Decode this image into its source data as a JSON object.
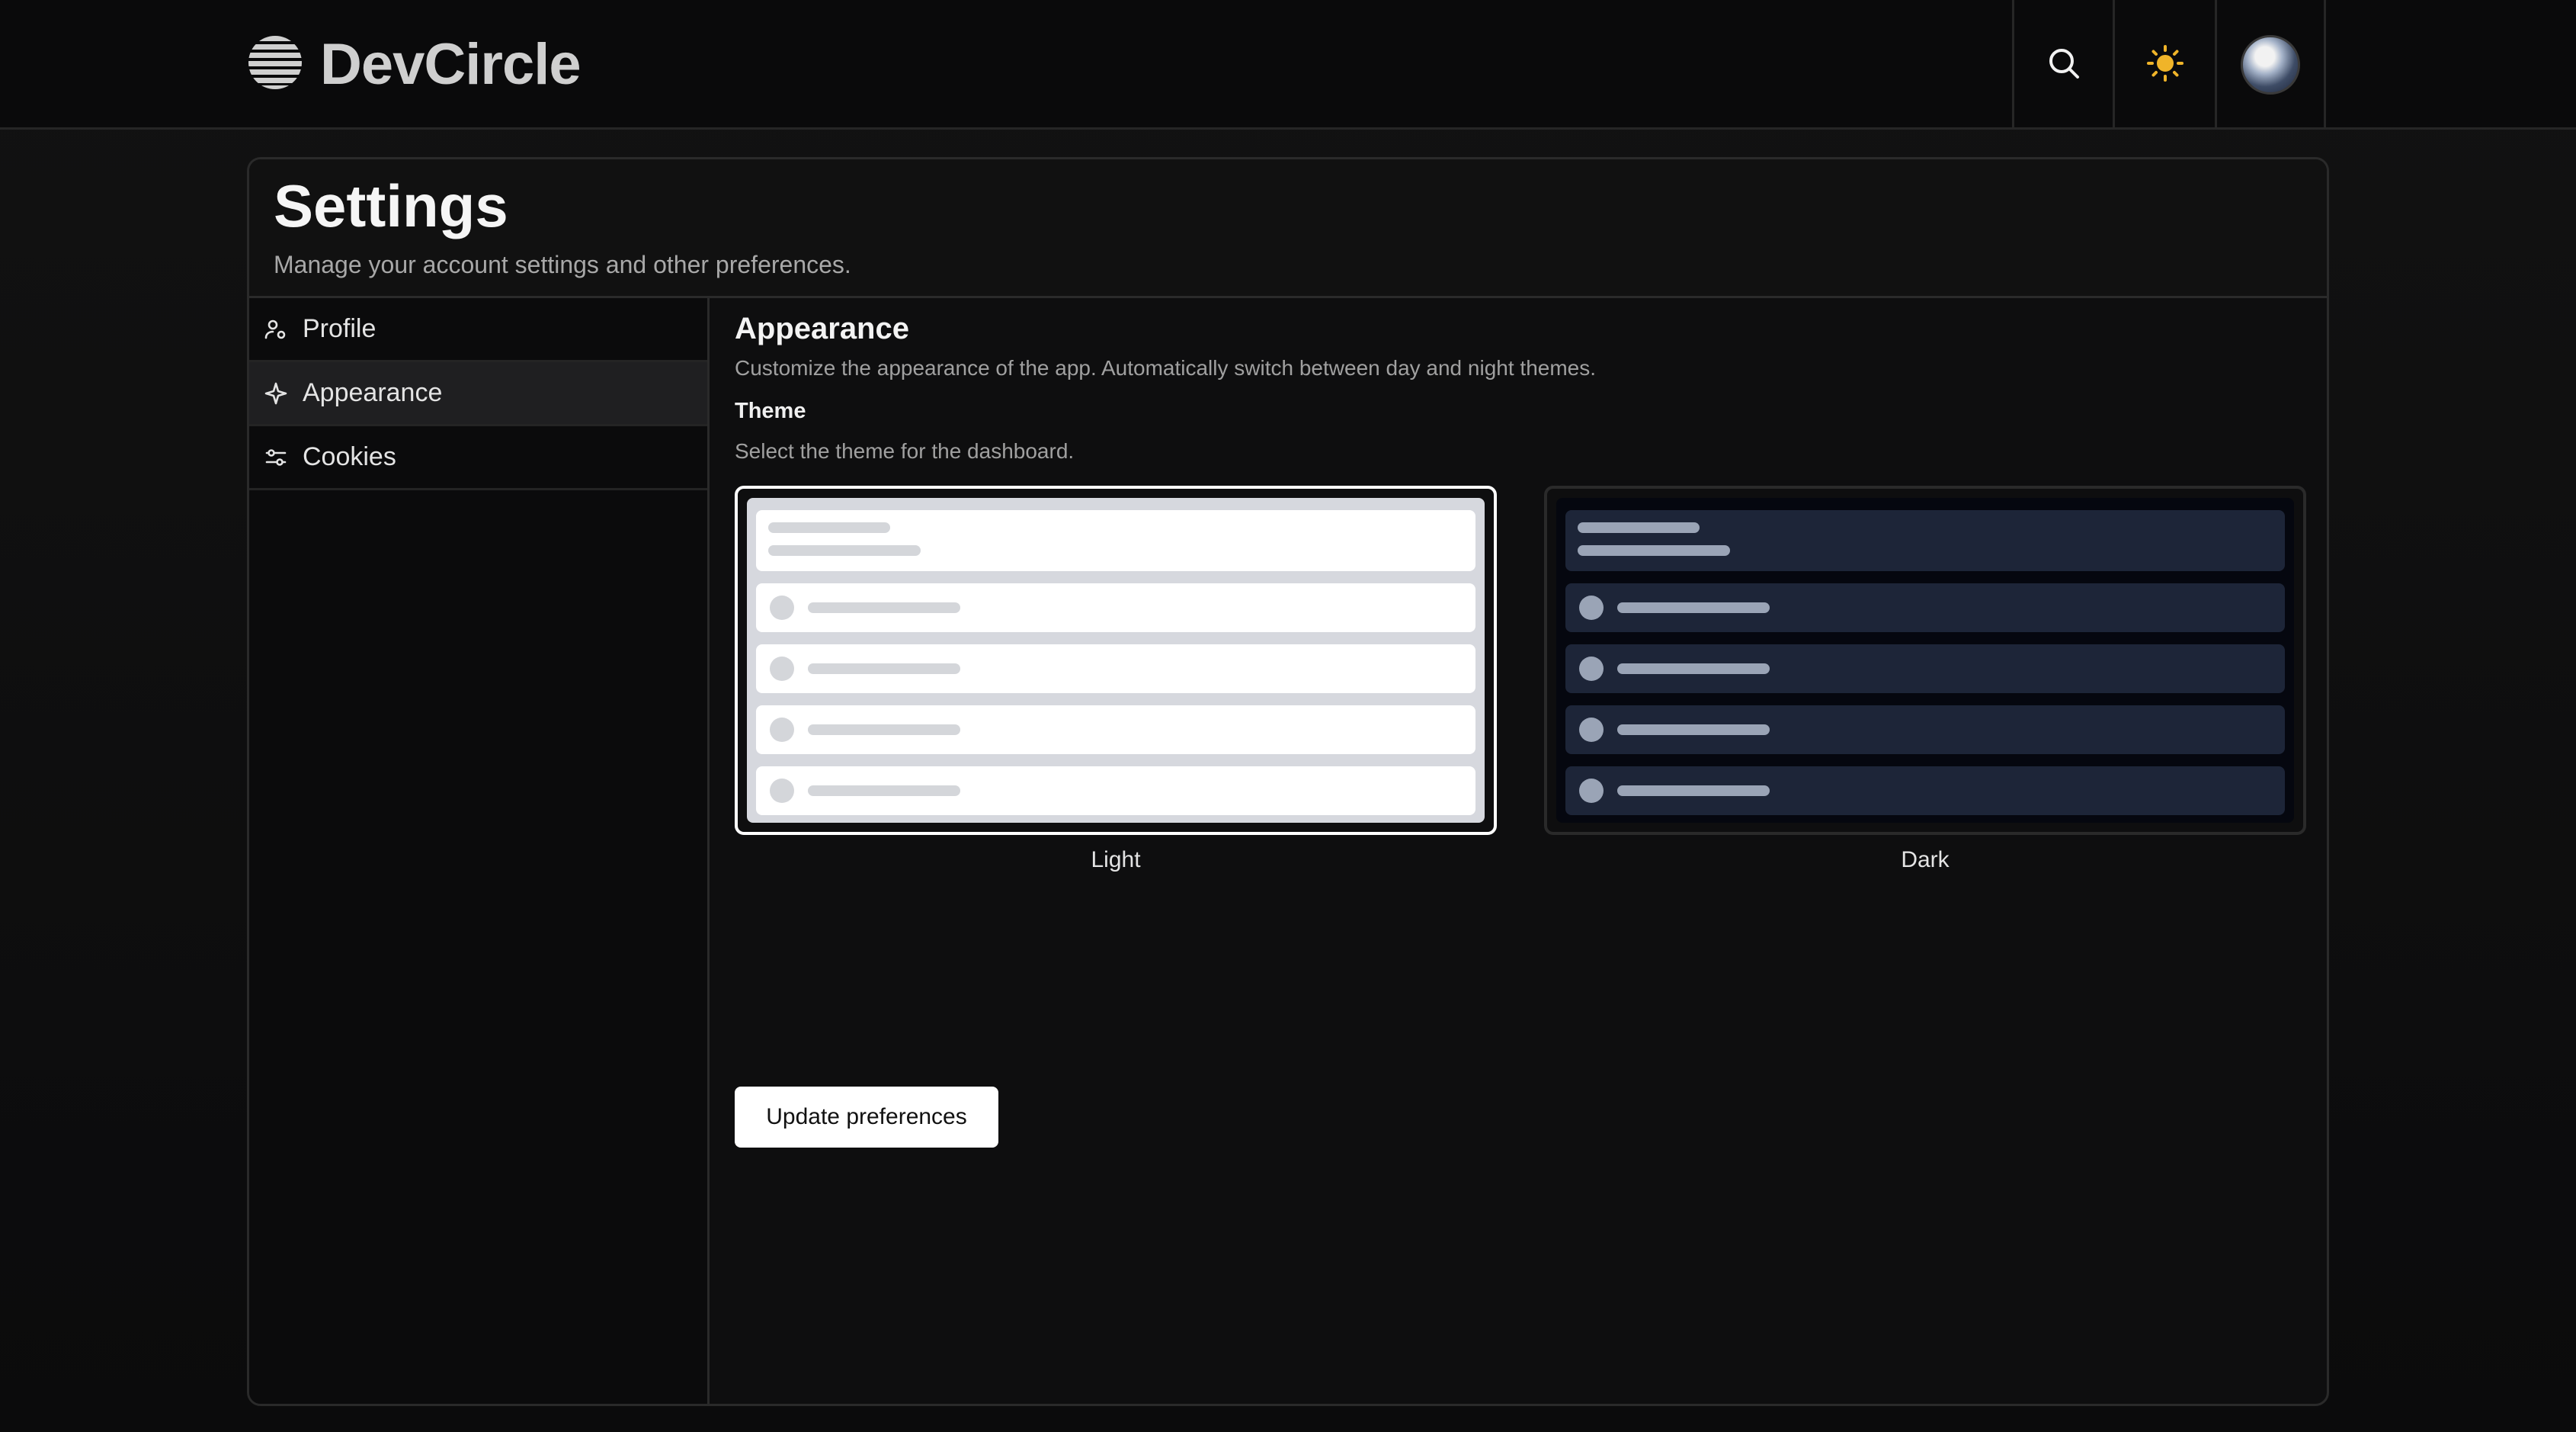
{
  "app": {
    "name": "DevCircle",
    "logo_icon": "globe-stripes-icon"
  },
  "header": {
    "search_icon": "search-icon",
    "theme_toggle_icon": "sun-icon",
    "avatar_icon": "user-avatar",
    "accent_color": "#f0b429"
  },
  "page": {
    "title": "Settings",
    "subtitle": "Manage your account settings and other preferences."
  },
  "sidebar": {
    "items": [
      {
        "label": "Profile",
        "icon": "user-settings-icon",
        "active": false
      },
      {
        "label": "Appearance",
        "icon": "sparkle-icon",
        "active": true
      },
      {
        "label": "Cookies",
        "icon": "sliders-icon",
        "active": false
      }
    ]
  },
  "appearance": {
    "title": "Appearance",
    "description": "Customize the appearance of the app. Automatically switch between day and night themes.",
    "theme_label": "Theme",
    "theme_description": "Select the theme for the dashboard.",
    "options": [
      {
        "label": "Light",
        "selected": true
      },
      {
        "label": "Dark",
        "selected": false
      }
    ],
    "submit_label": "Update preferences"
  }
}
